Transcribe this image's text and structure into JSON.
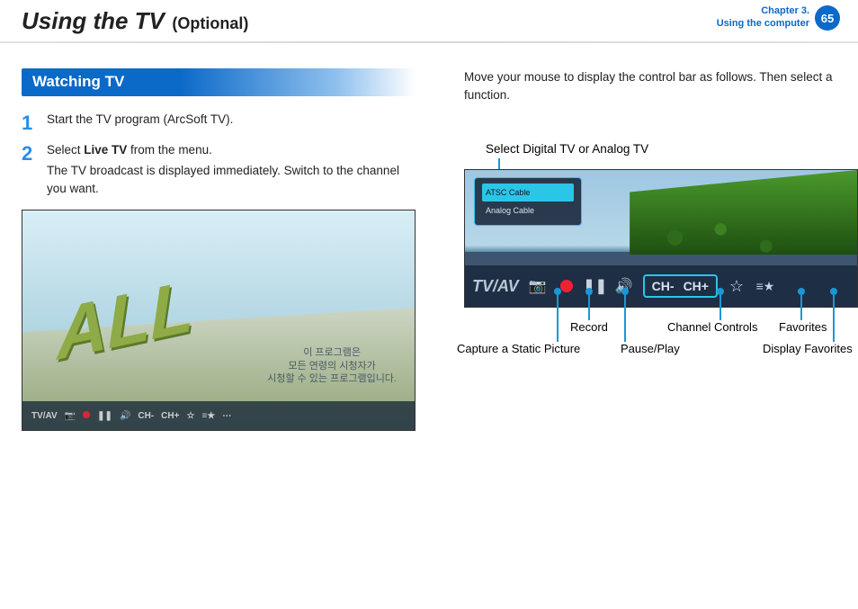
{
  "header": {
    "title_main": "Using the TV",
    "title_sub": "(Optional)",
    "chapter_line1": "Chapter 3.",
    "chapter_line2": "Using the computer",
    "page_number": "65"
  },
  "left": {
    "section_title": "Watching TV",
    "steps": [
      {
        "num": "1",
        "text": "Start the TV program (ArcSoft TV)."
      },
      {
        "num": "2",
        "text_a": "Select ",
        "text_bold": "Live TV",
        "text_b": " from the menu.",
        "text_extra": "The TV broadcast is displayed immediately. Switch to the channel you want."
      }
    ],
    "s1_caption_lines": [
      "이 프로그램은",
      "모든 연령의 시청자가",
      "시청할 수 있는 프로그램입니다."
    ],
    "s1_bar": {
      "tvav": "TV/AV",
      "ch_minus": "CH-",
      "ch_plus": "CH+"
    },
    "s1_logo": "ALL"
  },
  "right": {
    "intro": "Move your mouse to display the control bar as follows. Then select a function.",
    "callout_top": "Select Digital TV or Analog TV",
    "s2_menu_items": [
      "ATSC Cable",
      "Analog Cable"
    ],
    "s2_bar": {
      "tvav": "TV/AV",
      "ch_minus": "CH-",
      "ch_plus": "CH+"
    },
    "callouts": {
      "capture": "Capture a Static Picture",
      "record": "Record",
      "pauseplay": "Pause/Play",
      "channel": "Channel Controls",
      "favorites": "Favorites",
      "display_fav": "Display Favorites"
    }
  }
}
